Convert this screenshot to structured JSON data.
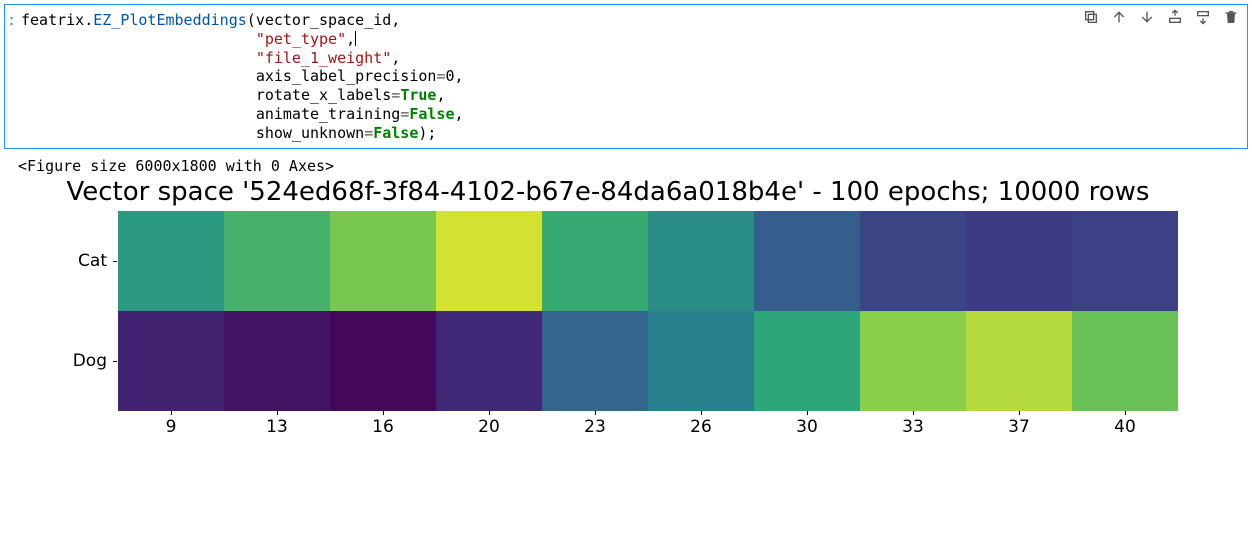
{
  "code": {
    "obj": "featrix",
    "func": "EZ_PlotEmbeddings",
    "arg_pos1": "vector_space_id",
    "arg_str1": "\"pet_type\"",
    "arg_str2": "\"file_1_weight\"",
    "kw1_name": "axis_label_precision",
    "kw1_val": "0",
    "kw2_name": "rotate_x_labels",
    "kw2_val": "True",
    "kw3_name": "animate_training",
    "kw3_val": "False",
    "kw4_name": "show_unknown",
    "kw4_val": "False"
  },
  "output": {
    "figure_text": "<Figure size 6000x1800 with 0 Axes>",
    "title": "Vector space '524ed68f-3f84-4102-b67e-84da6a018b4e' - 100 epochs; 10000 rows"
  },
  "chart_data": {
    "type": "heatmap",
    "title": "Vector space '524ed68f-3f84-4102-b67e-84da6a018b4e' - 100 epochs; 10000 rows",
    "y_categories": [
      "Cat",
      "Dog"
    ],
    "x_categories": [
      "9",
      "13",
      "16",
      "20",
      "23",
      "26",
      "30",
      "33",
      "37",
      "40"
    ],
    "values": [
      [
        0.55,
        0.65,
        0.75,
        0.9,
        0.62,
        0.5,
        0.32,
        0.22,
        0.18,
        0.2
      ],
      [
        0.1,
        0.05,
        0.02,
        0.12,
        0.35,
        0.45,
        0.6,
        0.78,
        0.85,
        0.72
      ]
    ]
  },
  "toolbar": {
    "copy": "Copy cell",
    "up": "Move up",
    "down": "Move down",
    "above": "Insert above",
    "below": "Insert below",
    "delete": "Delete cell"
  }
}
